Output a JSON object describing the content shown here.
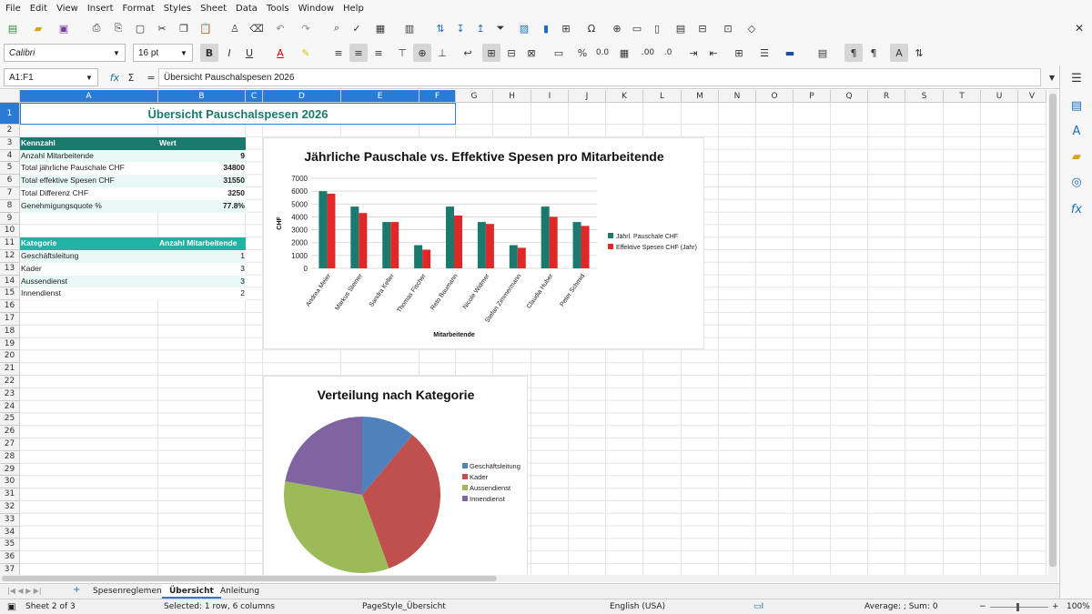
{
  "menu": [
    "File",
    "Edit",
    "View",
    "Insert",
    "Format",
    "Styles",
    "Sheet",
    "Data",
    "Tools",
    "Window",
    "Help"
  ],
  "font": {
    "name": "Calibri",
    "size": "16 pt"
  },
  "name_box": "A1:F1",
  "formula": "Übersicht Pauschalspesen 2026",
  "columns": [
    "A",
    "B",
    "C",
    "D",
    "E",
    "F",
    "G",
    "H",
    "I",
    "J",
    "K",
    "L",
    "M",
    "N",
    "O",
    "P",
    "Q",
    "R",
    "S",
    "T",
    "U",
    "V"
  ],
  "rows": [
    "1",
    "2",
    "3",
    "4",
    "5",
    "6",
    "7",
    "8",
    "9",
    "10",
    "11",
    "12",
    "13",
    "14",
    "15",
    "16",
    "17",
    "18",
    "19",
    "20",
    "21",
    "22",
    "23",
    "24",
    "25",
    "26",
    "27",
    "28",
    "29",
    "30",
    "31",
    "32",
    "33",
    "34",
    "35",
    "36",
    "37"
  ],
  "sheet": {
    "title": "Übersicht Pauschalspesen 2026",
    "summary_header": [
      "Kennzahl",
      "Wert"
    ],
    "summary_rows": [
      {
        "label": "Anzahl Mitarbeitende",
        "value": "9"
      },
      {
        "label": "Total jährliche Pauschale CHF",
        "value": "34800"
      },
      {
        "label": "Total effektive Spesen CHF",
        "value": "31550"
      },
      {
        "label": "Total Differenz CHF",
        "value": "3250"
      },
      {
        "label": "Genehmigungsquote %",
        "value": "77.8%"
      }
    ],
    "category_header": [
      "Kategorie",
      "Anzahl Mitarbeitende"
    ],
    "category_rows": [
      {
        "label": "Geschäftsleitung",
        "value": "1"
      },
      {
        "label": "Kader",
        "value": "3"
      },
      {
        "label": "Aussendienst",
        "value": "3"
      },
      {
        "label": "Innendienst",
        "value": "2"
      }
    ]
  },
  "colors": {
    "teal_header": "#1a7a6e",
    "teal_light": "#21b3a3",
    "bar1": "#1a7a6e",
    "bar2": "#e02828",
    "pie1": "#4f81bd",
    "pie2": "#c0504d",
    "pie3": "#9bbb59",
    "pie4": "#8064a2",
    "select": "#2a7ad6"
  },
  "chart_data": [
    {
      "type": "bar",
      "title": "Jährliche Pauschale vs. Effektive Spesen pro Mitarbeitende",
      "xlabel": "Mitarbeitende",
      "ylabel": "CHF",
      "ylim": [
        0,
        7000
      ],
      "yticks": [
        "0",
        "1000",
        "2000",
        "3000",
        "4000",
        "5000",
        "6000",
        "7000"
      ],
      "grid": true,
      "legend": "right",
      "categories": [
        "Andrea Meier",
        "Markus Steiner",
        "Sandra Keller",
        "Thomas Fischer",
        "Reto Baumann",
        "Nicole Widmer",
        "Stefan Zimmermann",
        "Claudia Huber",
        "Peter Schmid"
      ],
      "series": [
        {
          "name": "Jährl. Pauschale CHF",
          "values": [
            6000,
            4800,
            3600,
            1800,
            4800,
            3600,
            1800,
            4800,
            3600
          ]
        },
        {
          "name": "Effektive Spesen CHF (Jahr)",
          "values": [
            5800,
            4300,
            3600,
            1450,
            4100,
            3450,
            1600,
            4000,
            3300
          ]
        }
      ]
    },
    {
      "type": "pie",
      "title": "Verteilung nach Kategorie",
      "legend": "right",
      "categories": [
        "Geschäftsleitung",
        "Kader",
        "Aussendienst",
        "Innendienst"
      ],
      "values": [
        1,
        3,
        3,
        2
      ]
    }
  ],
  "tabs": [
    "Spesenreglement",
    "Übersicht",
    "Anleitung"
  ],
  "status": {
    "sheet": "Sheet 2 of 3",
    "selection": "Selected: 1 row, 6 columns",
    "pagestyle": "PageStyle_Übersicht",
    "lang": "English (USA)",
    "sum": "Average: ; Sum: 0",
    "zoom": "100%"
  }
}
